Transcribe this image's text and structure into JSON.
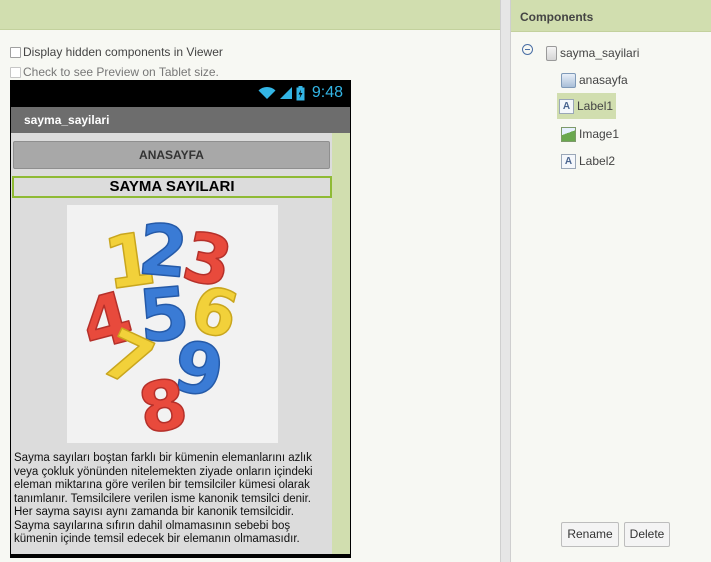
{
  "viewer": {
    "display_hidden_label": "Display hidden components in Viewer",
    "preview_tablet_label": "Check to see Preview on Tablet size."
  },
  "phone": {
    "status_time": "9:48",
    "screen_title": "sayma_sayilari",
    "button_text": "ANASAYFA",
    "label1_text": "SAYMA SAYILARI",
    "image_digits": [
      "1",
      "2",
      "3",
      "4",
      "5",
      "6",
      "7",
      "8",
      "9"
    ],
    "label2_lines": [
      "Sayma sayıları boştan farklı bir kümenin elemanlarını azlık",
      "veya çokluk yönünden nitelemekten ziyade onların içindeki",
      "eleman miktarına göre verilen bir temsilciler kümesi olarak",
      "tanımlanır. Temsilcilere verilen isme kanonik temsilci denir.",
      "Her sayma sayısı aynı zamanda bir kanonik temsilcidir.",
      "Sayma sayılarına sıfırın dahil olmamasının sebebi boş",
      "kümenin içinde temsil edecek bir elemanın olmamasıdır."
    ]
  },
  "components": {
    "header": "Components",
    "tree": [
      {
        "name": "sayma_sayilari",
        "icon": "screen-icon"
      },
      {
        "name": "anasayfa",
        "icon": "button-icon"
      },
      {
        "name": "Label1",
        "icon": "label-icon",
        "selected": true
      },
      {
        "name": "Image1",
        "icon": "image-icon"
      },
      {
        "name": "Label2",
        "icon": "label-icon"
      }
    ],
    "rename_label": "Rename",
    "delete_label": "Delete"
  },
  "colors": {
    "header_green": "#d1deaf",
    "selected_border": "#8fba35",
    "status_blue": "#33b5e5"
  }
}
